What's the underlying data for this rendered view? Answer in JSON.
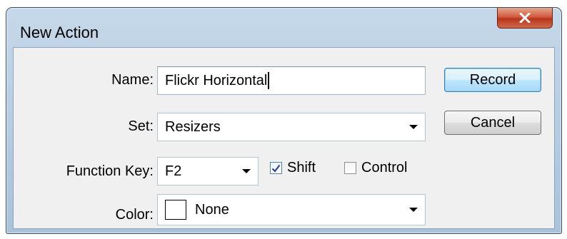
{
  "window": {
    "title": "New Action"
  },
  "fields": {
    "name": {
      "label": "Name:",
      "value": "Flickr Horizontal"
    },
    "set": {
      "label": "Set:",
      "value": "Resizers"
    },
    "function_key": {
      "label": "Function Key:",
      "value": "F2",
      "shift": {
        "label": "Shift",
        "checked": true
      },
      "control": {
        "label": "Control",
        "checked": false
      }
    },
    "color": {
      "label": "Color:",
      "value": "None",
      "swatch_color": "#ffffff"
    }
  },
  "buttons": {
    "record": "Record",
    "cancel": "Cancel"
  },
  "icons": {
    "close": "close-icon",
    "dropdown": "chevron-down-icon",
    "check": "checkmark-icon"
  }
}
